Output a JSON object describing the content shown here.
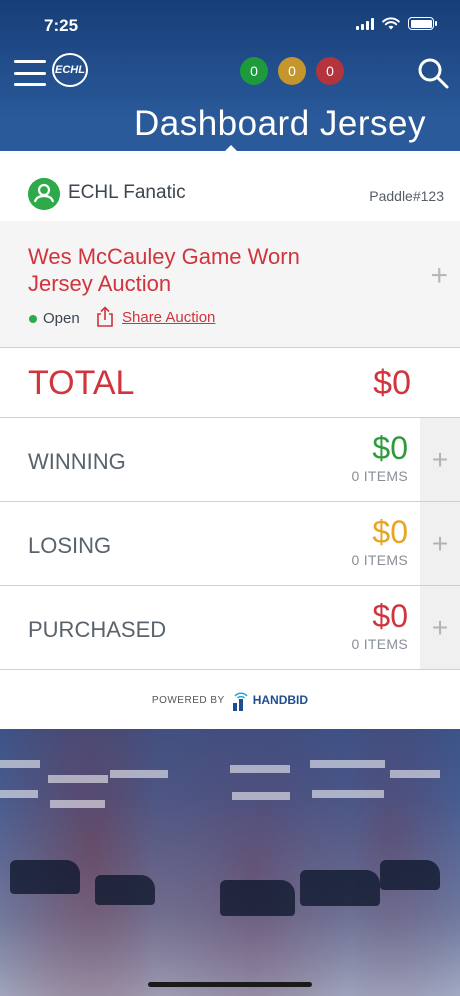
{
  "status_bar": {
    "time": "7:25"
  },
  "header": {
    "logo_text": "ECHL",
    "title": "Dashboard Jersey",
    "counters": [
      {
        "value": "0",
        "color": "#1c9a3c"
      },
      {
        "value": "0",
        "color": "#c5952e"
      },
      {
        "value": "0",
        "color": "#b3343c"
      }
    ]
  },
  "user": {
    "name": "ECHL Fanatic",
    "paddle": "Paddle#123"
  },
  "auction": {
    "title": "Wes McCauley Game Worn Jersey Auction",
    "status": "Open",
    "share_label": "Share Auction"
  },
  "total": {
    "label": "TOTAL",
    "value": "$0"
  },
  "rows": [
    {
      "label": "WINNING",
      "amount": "$0",
      "items": "0 ITEMS",
      "color": "#2e9a3c"
    },
    {
      "label": "LOSING",
      "amount": "$0",
      "items": "0 ITEMS",
      "color": "#e8a524"
    },
    {
      "label": "PURCHASED",
      "amount": "$0",
      "items": "0 ITEMS",
      "color": "#d0343c"
    }
  ],
  "footer": {
    "powered_by": "POWERED BY",
    "brand": "HANDBID"
  }
}
